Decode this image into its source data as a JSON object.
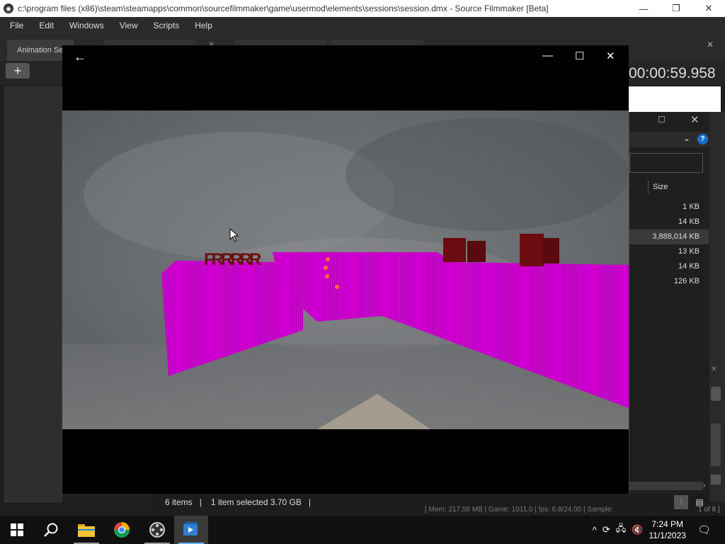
{
  "window": {
    "title": "c:\\program files (x86)\\steam\\steamapps\\common\\sourcefilmmaker\\game\\usermod\\elements\\sessions\\session.dmx - Source Filmmaker [Beta]",
    "minimize": "—",
    "restore": "❐",
    "close": "✕"
  },
  "menu": [
    "File",
    "Edit",
    "Windows",
    "View",
    "Scripts",
    "Help"
  ],
  "sfm": {
    "tab_label": "Animation Se",
    "tab_close": "✕",
    "add_label": "+",
    "timecode": "00:00:59.958",
    "status_text": "[ Mem:   217.58 MB | Game:   1011.0 | fps:     6.8/24.00 | Sample:",
    "status_end": "1 of 8 ]",
    "right_close": "✕"
  },
  "explorer": {
    "maximize": "☐",
    "close": "✕",
    "chevron": "⌄",
    "help": "?",
    "size_header": "Size",
    "sizes": [
      "1 KB",
      "14 KB",
      "3,888,014 KB",
      "13 KB",
      "14 KB",
      "126 KB"
    ],
    "selected_row": 2,
    "status_items": "6 items",
    "status_selected": "1 item selected  3.70 GB",
    "separator": "|",
    "scroll_arrow": "›"
  },
  "player": {
    "back": "←",
    "minimize": "—",
    "maximize": "☐",
    "close": "✕"
  },
  "taskbar": {
    "time": "7:24 PM",
    "date": "11/1/2023",
    "chevron": "^",
    "notifications": "🗨"
  },
  "colors": {
    "magenta": "#d400d6",
    "sky": "#6f7377",
    "taskbar": "#101010",
    "help_blue": "#1a6fd1"
  }
}
